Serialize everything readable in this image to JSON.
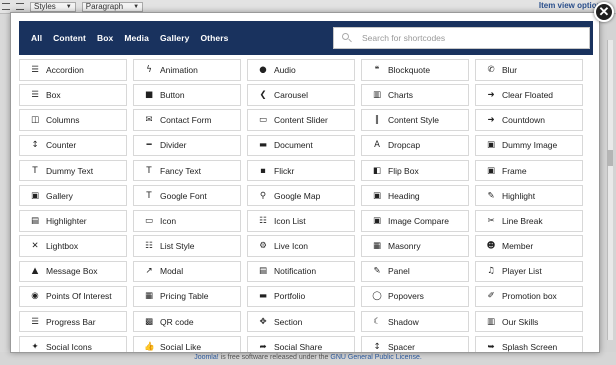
{
  "background": {
    "toolbar_styles": "Styles",
    "toolbar_paragraph": "Paragraph",
    "right_item": "Item view options",
    "footer_prefix": "Joomla!",
    "footer_mid": " is free software released under the ",
    "footer_license": "GNU General Public License."
  },
  "modal": {
    "close_glyph": "✕",
    "filters": [
      "All",
      "Content",
      "Box",
      "Media",
      "Gallery",
      "Others"
    ],
    "search_placeholder": "Search for shortcodes",
    "items": [
      {
        "label": "Accordion",
        "icon": "list-icon",
        "glyph": "☰"
      },
      {
        "label": "Animation",
        "icon": "bolt-icon",
        "glyph": "ϟ"
      },
      {
        "label": "Audio",
        "icon": "play-circle-icon",
        "glyph": "●"
      },
      {
        "label": "Blockquote",
        "icon": "quote-icon",
        "glyph": "❝"
      },
      {
        "label": "Blur",
        "icon": "phone-icon",
        "glyph": "✆"
      },
      {
        "label": "Box",
        "icon": "list-box-icon",
        "glyph": "☰"
      },
      {
        "label": "Button",
        "icon": "stop-icon",
        "glyph": "■"
      },
      {
        "label": "Carousel",
        "icon": "carousel-icon",
        "glyph": "❮"
      },
      {
        "label": "Charts",
        "icon": "bar-chart-icon",
        "glyph": "▥"
      },
      {
        "label": "Clear Floated",
        "icon": "sign-in-icon",
        "glyph": "➜"
      },
      {
        "label": "Columns",
        "icon": "columns-icon",
        "glyph": "◫"
      },
      {
        "label": "Contact Form",
        "icon": "envelope-icon",
        "glyph": "✉"
      },
      {
        "label": "Content Slider",
        "icon": "monitor-icon",
        "glyph": "▭"
      },
      {
        "label": "Content Style",
        "icon": "text-height-icon",
        "glyph": "‖"
      },
      {
        "label": "Countdown",
        "icon": "sign-out-icon",
        "glyph": "➜"
      },
      {
        "label": "Counter",
        "icon": "sort-numeric-icon",
        "glyph": "↕"
      },
      {
        "label": "Divider",
        "icon": "minus-icon",
        "glyph": "━"
      },
      {
        "label": "Document",
        "icon": "file-icon",
        "glyph": "▬"
      },
      {
        "label": "Dropcap",
        "icon": "font-icon",
        "glyph": "A"
      },
      {
        "label": "Dummy Image",
        "icon": "picture-icon",
        "glyph": "▣"
      },
      {
        "label": "Dummy Text",
        "icon": "text-icon",
        "glyph": "T"
      },
      {
        "label": "Fancy Text",
        "icon": "text-icon",
        "glyph": "T"
      },
      {
        "label": "Flickr",
        "icon": "flickr-icon",
        "glyph": "▪"
      },
      {
        "label": "Flip Box",
        "icon": "flip-icon",
        "glyph": "◧"
      },
      {
        "label": "Frame",
        "icon": "picture-icon",
        "glyph": "▣"
      },
      {
        "label": "Gallery",
        "icon": "picture-icon",
        "glyph": "▣"
      },
      {
        "label": "Google Font",
        "icon": "text-icon",
        "glyph": "T"
      },
      {
        "label": "Google Map",
        "icon": "map-marker-icon",
        "glyph": "⚲"
      },
      {
        "label": "Heading",
        "icon": "header-icon",
        "glyph": "▣"
      },
      {
        "label": "Highlight",
        "icon": "pencil-icon",
        "glyph": "✎"
      },
      {
        "label": "Highlighter",
        "icon": "code-box-icon",
        "glyph": "▤"
      },
      {
        "label": "Icon",
        "icon": "desktop-icon",
        "glyph": "▭"
      },
      {
        "label": "Icon List",
        "icon": "list-icon",
        "glyph": "☷"
      },
      {
        "label": "Image Compare",
        "icon": "picture-icon",
        "glyph": "▣"
      },
      {
        "label": "Line Break",
        "icon": "scissors-icon",
        "glyph": "✂"
      },
      {
        "label": "Lightbox",
        "icon": "expand-icon",
        "glyph": "✕"
      },
      {
        "label": "List Style",
        "icon": "list-ul-icon",
        "glyph": "☷"
      },
      {
        "label": "Live Icon",
        "icon": "gear-icon",
        "glyph": "⚙"
      },
      {
        "label": "Masonry",
        "icon": "th-icon",
        "glyph": "▦"
      },
      {
        "label": "Member",
        "icon": "users-icon",
        "glyph": "☻"
      },
      {
        "label": "Message Box",
        "icon": "warning-icon",
        "glyph": "▲"
      },
      {
        "label": "Modal",
        "icon": "external-link-icon",
        "glyph": "↗"
      },
      {
        "label": "Notification",
        "icon": "calendar-icon",
        "glyph": "▤"
      },
      {
        "label": "Panel",
        "icon": "edit-icon",
        "glyph": "✎"
      },
      {
        "label": "Player List",
        "icon": "music-icon",
        "glyph": "♫"
      },
      {
        "label": "Points Of Interest",
        "icon": "dot-circle-icon",
        "glyph": "◉"
      },
      {
        "label": "Pricing Table",
        "icon": "table-icon",
        "glyph": "▦"
      },
      {
        "label": "Portfolio",
        "icon": "briefcase-icon",
        "glyph": "▬"
      },
      {
        "label": "Popovers",
        "icon": "comment-icon",
        "glyph": "◯"
      },
      {
        "label": "Promotion box",
        "icon": "pencil-icon",
        "glyph": "✐"
      },
      {
        "label": "Progress Bar",
        "icon": "tasks-icon",
        "glyph": "☰"
      },
      {
        "label": "QR code",
        "icon": "qrcode-icon",
        "glyph": "▩"
      },
      {
        "label": "Section",
        "icon": "arrows-icon",
        "glyph": "✥"
      },
      {
        "label": "Shadow",
        "icon": "moon-icon",
        "glyph": "☾"
      },
      {
        "label": "Our Skills",
        "icon": "bar-chart-icon",
        "glyph": "▥"
      },
      {
        "label": "Social Icons",
        "icon": "twitter-icon",
        "glyph": "✦"
      },
      {
        "label": "Social Like",
        "icon": "thumbs-up-icon",
        "glyph": "👍"
      },
      {
        "label": "Social Share",
        "icon": "share-icon",
        "glyph": "➦"
      },
      {
        "label": "Spacer",
        "icon": "arrows-v-icon",
        "glyph": "↕"
      },
      {
        "label": "Splash Screen",
        "icon": "share-box-icon",
        "glyph": "➥"
      }
    ]
  }
}
